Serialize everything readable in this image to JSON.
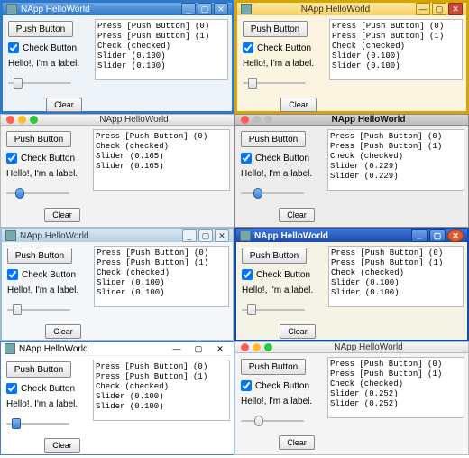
{
  "windows": [
    {
      "id": "w1",
      "frame": "w1-frame",
      "tb": "w1-tb",
      "title": "NApp HelloWorld",
      "titleAlign": "left",
      "icon": true,
      "controls": "win-3",
      "push": "Push Button",
      "check": "Check Button",
      "checked": true,
      "label": "Hello!, I'm a label.",
      "clear": "Clear",
      "slider": 0.1,
      "thumb": "",
      "log": [
        "Press [Push Button] (0)",
        "Press [Push Button] (1)",
        "Check (checked)",
        "Slider (0.100)",
        "Slider (0.100)"
      ]
    },
    {
      "id": "w2",
      "frame": "w2-frame",
      "tb": "w2-tb",
      "title": "NApp HelloWorld",
      "titleAlign": "center",
      "icon": true,
      "controls": "win-flat",
      "push": "Push Button",
      "check": "Check Button",
      "checked": true,
      "label": "Hello!, I'm a label.",
      "clear": "Clear",
      "slider": 0.1,
      "thumb": "",
      "log": [
        "Press [Push Button] (0)",
        "Press [Push Button] (1)",
        "Check (checked)",
        "Slider (0.100)",
        "Slider (0.100)"
      ]
    },
    {
      "id": "w3",
      "frame": "mac-frame",
      "tb": "mac-tb",
      "title": "NApp HelloWorld",
      "titleAlign": "center",
      "icon": false,
      "controls": "mac-dots",
      "push": "Push Button",
      "check": "Check Button",
      "checked": true,
      "label": "Hello!, I'm a label.",
      "clear": "Clear",
      "slider": 0.165,
      "thumb": "round-thumb blue-thumb",
      "log": [
        "Press [Push Button] (0)",
        "Check (checked)",
        "Slider (0.165)",
        "Slider (0.165)"
      ]
    },
    {
      "id": "w4",
      "frame": "mac2-frame",
      "tb": "mac2-tb",
      "title": "NApp HelloWorld",
      "titleAlign": "center",
      "icon": false,
      "controls": "mac-dots-grey",
      "push": "Push Button",
      "check": "Check Button",
      "checked": true,
      "label": "Hello!, I'm a label.",
      "clear": "Clear",
      "slider": 0.229,
      "thumb": "round-thumb blue-thumb",
      "log": [
        "Press [Push Button] (0)",
        "Press [Push Button] (1)",
        "Check (checked)",
        "Slider (0.229)",
        "Slider (0.229)"
      ]
    },
    {
      "id": "w5",
      "frame": "kde-frame",
      "tb": "kde-tb",
      "title": "NApp HelloWorld",
      "titleAlign": "left",
      "icon": true,
      "controls": "kde",
      "push": "Push Button",
      "check": "Check Button",
      "checked": true,
      "label": "Hello!, I'm a label.",
      "clear": "Clear",
      "slider": 0.1,
      "thumb": "",
      "log": [
        "Press [Push Button] (0)",
        "Press [Push Button] (1)",
        "Check (checked)",
        "Slider (0.100)",
        "Slider (0.100)"
      ]
    },
    {
      "id": "w6",
      "frame": "gn-frame",
      "tb": "gn-tb",
      "title": "NApp HelloWorld",
      "titleAlign": "left",
      "icon": true,
      "controls": "gnome",
      "push": "Push Button",
      "check": "Check Button",
      "checked": true,
      "label": "Hello!, I'm a label.",
      "clear": "Clear",
      "slider": 0.1,
      "thumb": "",
      "log": [
        "Press [Push Button] (0)",
        "Press [Push Button] (1)",
        "Check (checked)",
        "Slider (0.100)",
        "Slider (0.100)"
      ]
    },
    {
      "id": "w7",
      "frame": "w10-frame",
      "tb": "w10-tb",
      "title": "NApp HelloWorld",
      "titleAlign": "left",
      "icon": true,
      "controls": "win10",
      "push": "Push Button",
      "check": "Check Button",
      "checked": true,
      "label": "Hello!, I'm a label.",
      "clear": "Clear",
      "slider": 0.1,
      "thumb": "blue-thumb",
      "log": [
        "Press [Push Button] (0)",
        "Press [Push Button] (1)",
        "Check (checked)",
        "Slider (0.100)",
        "Slider (0.100)"
      ]
    },
    {
      "id": "w8",
      "frame": "mac3-frame",
      "tb": "mac3-tb",
      "title": "NApp HelloWorld",
      "titleAlign": "center",
      "icon": false,
      "controls": "mac-dots",
      "push": "Push Button",
      "check": "Check Button",
      "checked": true,
      "label": "Hello!, I'm a label.",
      "clear": "Clear",
      "slider": 0.252,
      "thumb": "round-thumb",
      "log": [
        "Press [Push Button] (0)",
        "Press [Push Button] (1)",
        "Check (checked)",
        "Slider (0.252)",
        "Slider (0.252)"
      ]
    }
  ],
  "glyphs": {
    "min": "_",
    "max": "▢",
    "close": "✕",
    "dash": "—"
  }
}
